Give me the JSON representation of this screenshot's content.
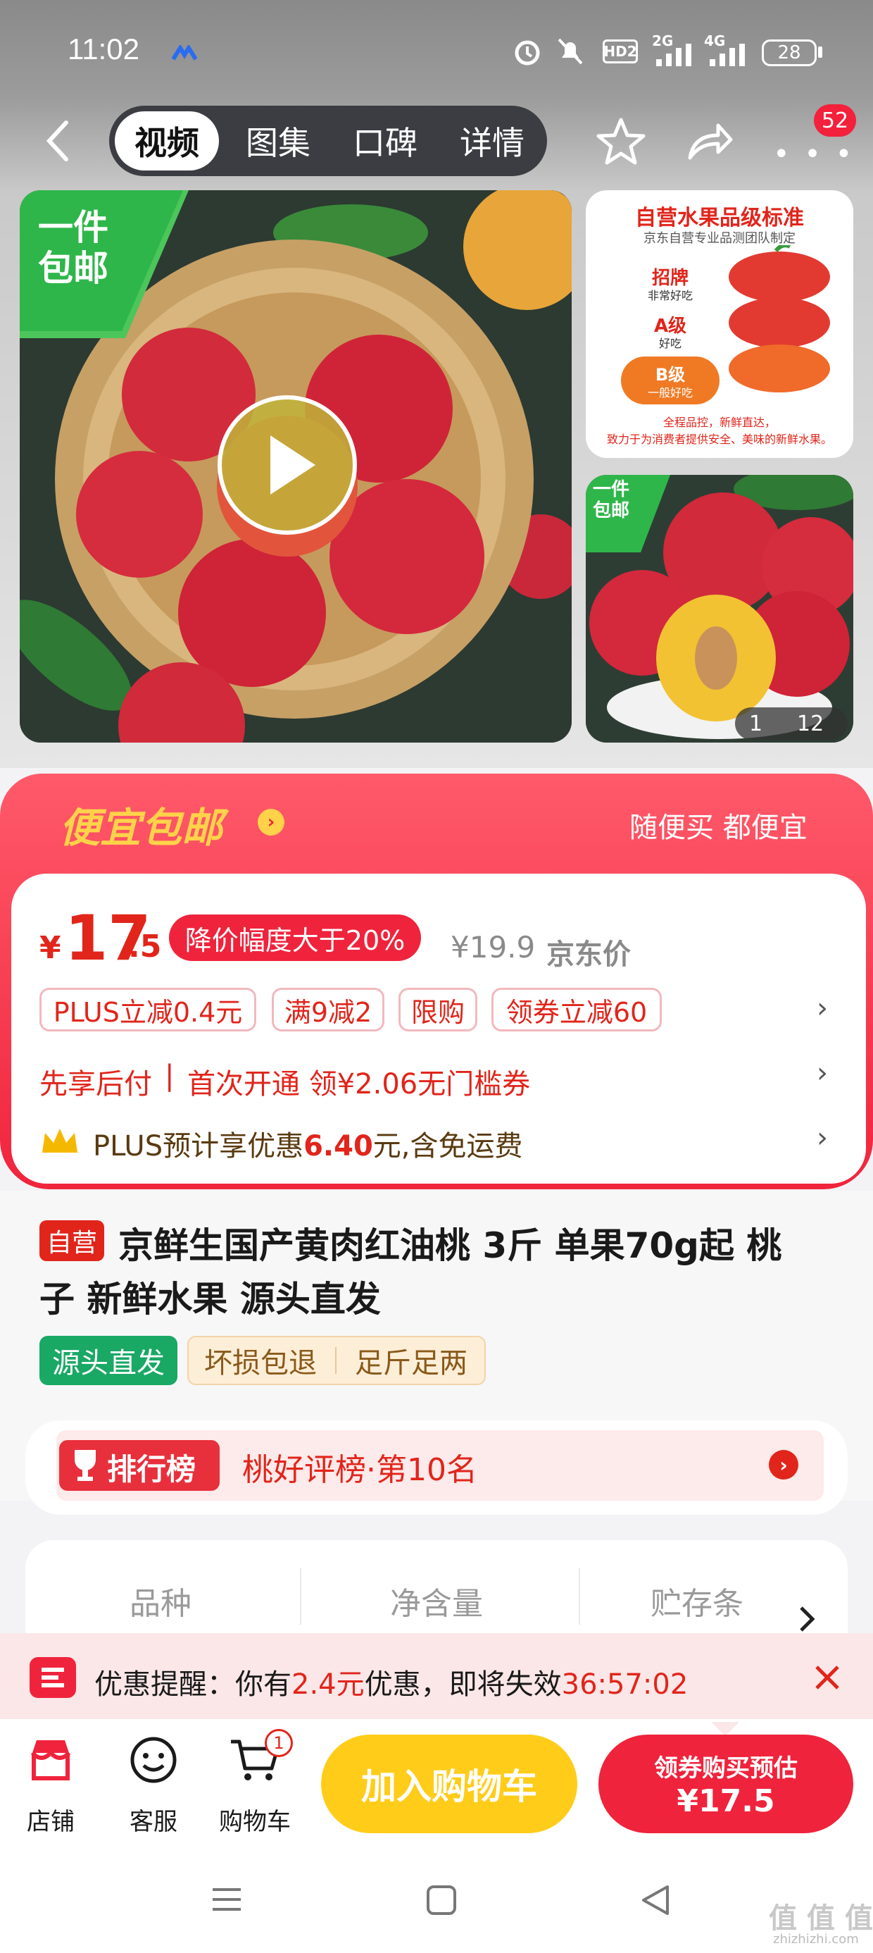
{
  "status_bar": {
    "time": "11:02",
    "network_1": "2G",
    "network_2": "4G",
    "hd": "HD2",
    "battery": "28"
  },
  "header": {
    "tabs": [
      "视频",
      "图集",
      "口碑",
      "详情"
    ],
    "cart_badge": "52"
  },
  "gallery": {
    "main_badge": [
      "一件",
      "包邮"
    ],
    "side1_title": "自营水果品级标准",
    "side1_subtitle": "京东自营专业品测团队制定",
    "side1_levels": [
      {
        "label": "招牌",
        "desc": "非常好吃"
      },
      {
        "label": "A级",
        "desc": "好吃"
      },
      {
        "label": "B级",
        "desc": "一般好吃"
      }
    ],
    "side1_footer_1": "全程品控，新鲜直达，",
    "side1_footer_2": "致力于为消费者提供安全、美味的新鲜水果。",
    "side2_badge": [
      "一件",
      "包邮"
    ],
    "counter_current": "1",
    "counter_total": "12"
  },
  "promo": {
    "banner_title": "便宜包邮",
    "banner_slogan": "随便买 都便宜",
    "price_symbol": "¥",
    "price_int": "17",
    "price_dec": ".5",
    "discount_tag": "降价幅度大于20%",
    "original_price": "¥19.9",
    "original_label": "京东价",
    "coupons": [
      "PLUS立减0.4元",
      "满9减2",
      "限购",
      "领券立减60"
    ],
    "pay_later": "先享后付",
    "pay_sep": "|",
    "pay_later_offer": "首次开通 领¥2.06无门槛券",
    "plus_prefix": "PLUS预计享优惠",
    "plus_amount": "6.40",
    "plus_suffix": "元,含免运费"
  },
  "product": {
    "self_tag": "自营",
    "title_line1": "京鲜生国产黄肉红油桃 3斤 单果70g起 桃",
    "title_line2": "子 新鲜水果 源头直发",
    "tags": [
      "源头直发",
      "坏损包退",
      "足斤足两"
    ]
  },
  "ranking": {
    "label": "排行榜",
    "text": "桃好评榜·第10名"
  },
  "specs": {
    "columns": [
      "品种",
      "净含量",
      "贮存条"
    ]
  },
  "reminder": {
    "prefix": "优惠提醒：你有",
    "amount": "2.4元",
    "middle": "优惠，即将失效",
    "countdown": "36:57:02"
  },
  "bottom_bar": {
    "store": "店铺",
    "service": "客服",
    "cart": "购物车",
    "cart_count": "1",
    "add_to_cart": "加入购物车",
    "buy_label": "领券购买预估",
    "buy_price": "¥17.5"
  },
  "watermark": {
    "text": "值 值 值",
    "domain": "zhizhizhi.com"
  }
}
